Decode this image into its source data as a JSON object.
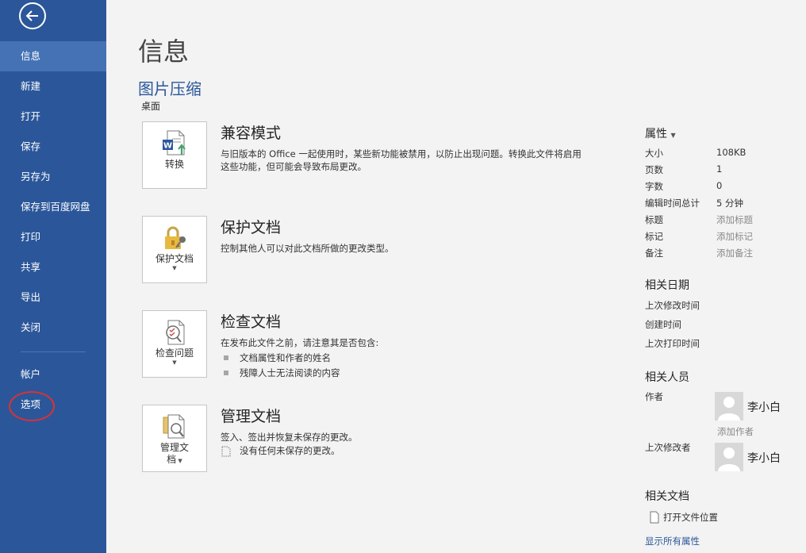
{
  "sidebar": {
    "back_icon": "back-arrow-icon",
    "items": [
      {
        "label": "信息",
        "active": true
      },
      {
        "label": "新建"
      },
      {
        "label": "打开"
      },
      {
        "label": "保存"
      },
      {
        "label": "另存为"
      },
      {
        "label": "保存到百度网盘"
      },
      {
        "label": "打印"
      },
      {
        "label": "共享"
      },
      {
        "label": "导出"
      },
      {
        "label": "关闭"
      }
    ],
    "account": "帐户",
    "options": "选项"
  },
  "main": {
    "title": "信息",
    "doc_name": "图片压缩",
    "doc_path": "桌面",
    "compat": {
      "button_label": "转换",
      "icon": "word-convert-icon",
      "heading": "兼容模式",
      "description": "与旧版本的 Office 一起使用时，某些新功能被禁用，以防止出现问题。转换此文件将启用这些功能，但可能会导致布局更改。"
    },
    "protect": {
      "button_label": "保护文档",
      "icon": "lock-key-icon",
      "heading": "保护文档",
      "description": "控制其他人可以对此文档所做的更改类型。"
    },
    "inspect": {
      "button_label": "检查问题",
      "icon": "inspect-document-icon",
      "heading": "检查文档",
      "description": "在发布此文件之前，请注意其是否包含:",
      "bullets": [
        "文档属性和作者的姓名",
        "残障人士无法阅读的内容"
      ]
    },
    "manage": {
      "button_label_1": "管理文",
      "button_label_2": "档",
      "icon": "manage-document-icon",
      "heading": "管理文档",
      "description": "签入、签出并恢复未保存的更改。",
      "note": "没有任何未保存的更改。"
    }
  },
  "properties": {
    "heading": "属性",
    "rows": [
      {
        "key": "大小",
        "value": "108KB"
      },
      {
        "key": "页数",
        "value": "1"
      },
      {
        "key": "字数",
        "value": "0"
      },
      {
        "key": "编辑时间总计",
        "value": "5 分钟"
      },
      {
        "key": "标题",
        "value": "添加标题"
      },
      {
        "key": "标记",
        "value": "添加标记"
      },
      {
        "key": "备注",
        "value": "添加备注"
      }
    ],
    "dates_heading": "相关日期",
    "dates": [
      "上次修改时间",
      "创建时间",
      "上次打印时间"
    ],
    "people_heading": "相关人员",
    "author_label": "作者",
    "author_name": "李小白",
    "add_author": "添加作者",
    "last_modified_by_label": "上次修改者",
    "last_modified_by_name": "李小白",
    "related_docs_heading": "相关文档",
    "open_location": "打开文件位置",
    "show_all": "显示所有属性"
  },
  "colors": {
    "sidebar": "#2b579a",
    "sidebar_active": "#4472b5",
    "accent": "#2b579a",
    "highlight_circle": "#e03030"
  }
}
